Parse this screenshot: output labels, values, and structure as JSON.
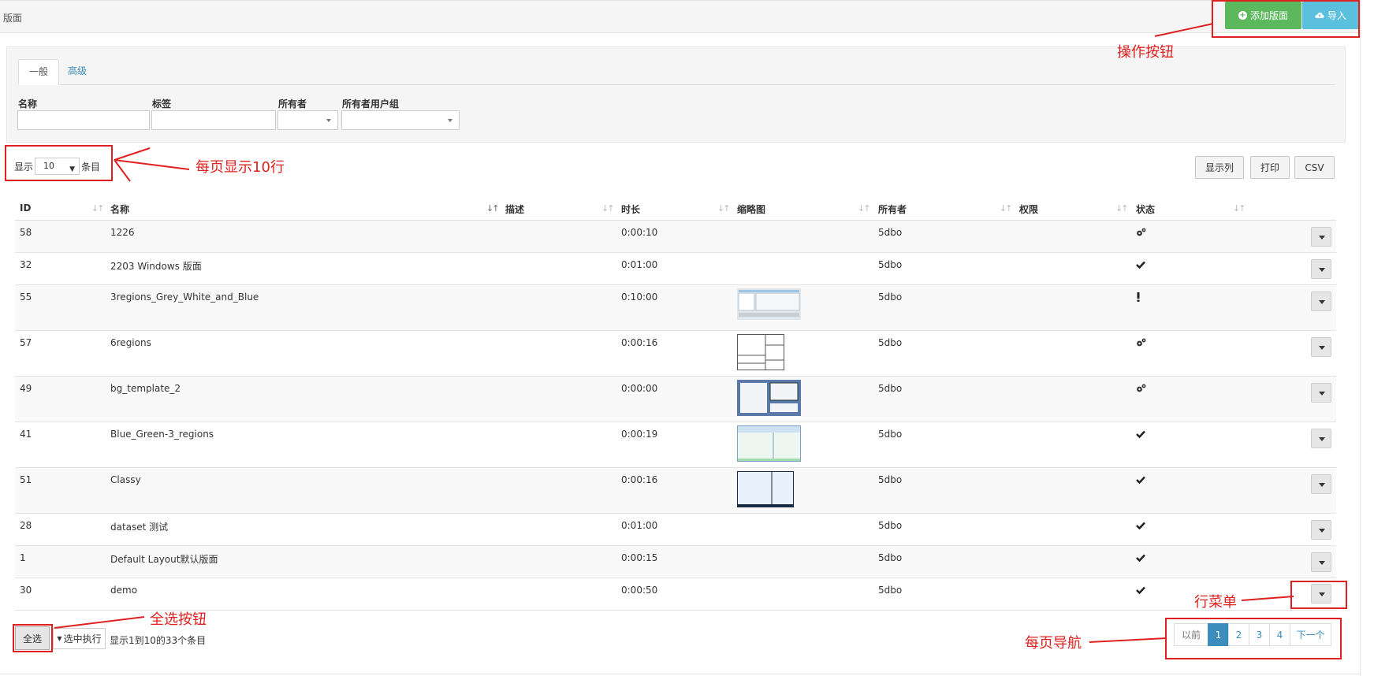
{
  "header": {
    "title": "版面",
    "add_button": "添加版面",
    "import_button": "导入"
  },
  "filter": {
    "tabs": [
      "一般",
      "高级"
    ],
    "labels": {
      "name": "名称",
      "tags": "标签",
      "owner": "所有者",
      "owner_group": "所有者用户组"
    }
  },
  "length": {
    "prefix": "显示",
    "value": "10",
    "suffix": "条目"
  },
  "tools": {
    "columns": "显示列",
    "print": "打印",
    "csv": "CSV"
  },
  "table": {
    "headers": [
      "ID",
      "名称",
      "描述",
      "时长",
      "缩略图",
      "所有者",
      "权限",
      "状态"
    ],
    "rows": [
      {
        "id": "58",
        "name": "1226",
        "duration": "0:00:10",
        "owner": "5dbo",
        "thumb": "none",
        "status": "gears-icon"
      },
      {
        "id": "32",
        "name": "2203 Windows 版面",
        "duration": "0:01:00",
        "owner": "5dbo",
        "thumb": "none",
        "status": "check-icon"
      },
      {
        "id": "55",
        "name": "3regions_Grey_White_and_Blue",
        "duration": "0:10:00",
        "owner": "5dbo",
        "thumb": "grey-white-blue",
        "status": "exclamation-icon"
      },
      {
        "id": "57",
        "name": "6regions",
        "duration": "0:00:16",
        "owner": "5dbo",
        "thumb": "six-regions",
        "status": "gears-icon"
      },
      {
        "id": "49",
        "name": "bg_template_2",
        "duration": "0:00:00",
        "owner": "5dbo",
        "thumb": "bg-template",
        "status": "gears-icon"
      },
      {
        "id": "41",
        "name": "Blue_Green-3_regions",
        "duration": "0:00:19",
        "owner": "5dbo",
        "thumb": "blue-green",
        "status": "check-icon"
      },
      {
        "id": "51",
        "name": "Classy",
        "duration": "0:00:16",
        "owner": "5dbo",
        "thumb": "classy",
        "status": "check-icon"
      },
      {
        "id": "28",
        "name": "dataset 测试",
        "duration": "0:01:00",
        "owner": "5dbo",
        "thumb": "none",
        "status": "check-icon"
      },
      {
        "id": "1",
        "name": "Default Layout默认版面",
        "duration": "0:00:15",
        "owner": "5dbo",
        "thumb": "none",
        "status": "check-icon"
      },
      {
        "id": "30",
        "name": "demo",
        "duration": "0:00:50",
        "owner": "5dbo",
        "thumb": "none",
        "status": "check-icon"
      }
    ]
  },
  "footer": {
    "select_all": "全选",
    "exec_selected": "选中执行",
    "info": "显示1到10的33个条目"
  },
  "pagination": {
    "prev": "以前",
    "pages": [
      "1",
      "2",
      "3",
      "4"
    ],
    "current": "1",
    "next": "下一个"
  },
  "annotations": {
    "action_buttons": "操作按钮",
    "per_page": "每页显示10行",
    "select_all": "全选按钮",
    "row_menu": "行菜单",
    "page_nav": "每页导航"
  },
  "colors": {
    "accent": "#3c8dbc",
    "success": "#5cb85c",
    "info": "#5bc0de",
    "annotation": "#e02020"
  }
}
